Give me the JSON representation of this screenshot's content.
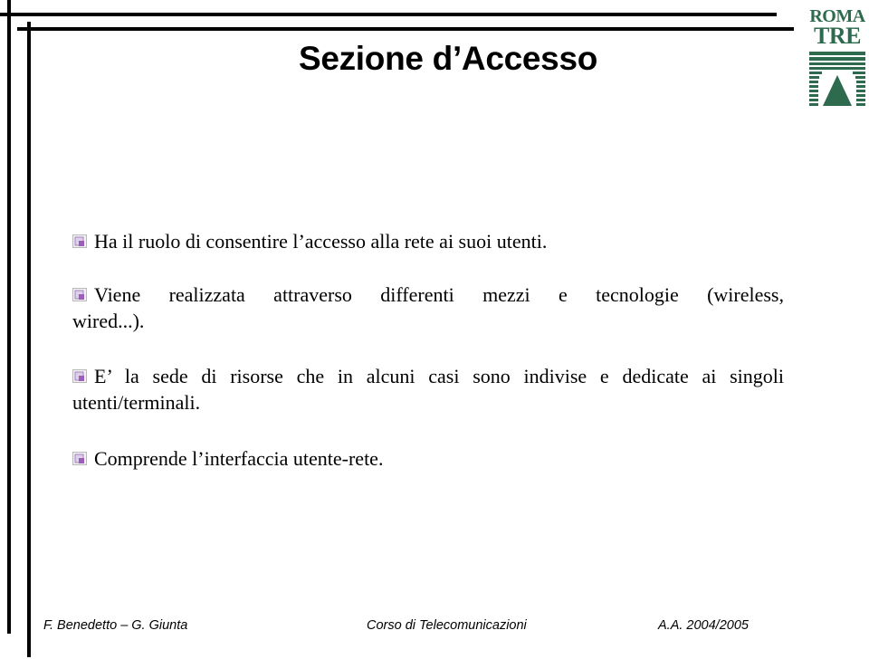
{
  "slide": {
    "title": "Sezione d’Accesso",
    "logo": {
      "line1": "ROMA",
      "line2": "TRE",
      "color": "#2e6a4e"
    },
    "bullet_icon": "slide-bullet-icon",
    "bullets": [
      {
        "text": "Ha il ruolo di consentire l’accesso alla rete ai suoi utenti."
      },
      {
        "line1": "Viene realizzata attraverso differenti mezzi e tecnologie (wireless,",
        "line2": "wired...)."
      },
      {
        "line1": "E’ la sede di risorse che in alcuni casi sono indivise e dedicate ai singoli",
        "line2": "utenti/terminali."
      },
      {
        "text": "Comprende l’interfaccia utente-rete."
      }
    ]
  },
  "footer": {
    "authors": "F. Benedetto – G. Giunta",
    "course": "Corso di Telecomunicazioni",
    "academic_year": "A.A. 2004/2005"
  }
}
